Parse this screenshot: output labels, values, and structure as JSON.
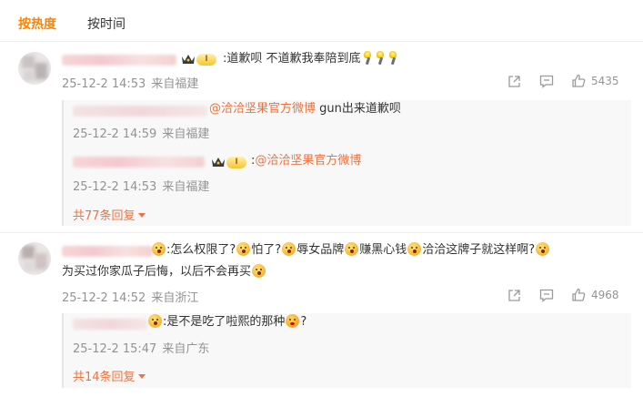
{
  "tabs": [
    {
      "label": "按热度",
      "active": true
    },
    {
      "label": "按时间",
      "active": false
    }
  ],
  "comments": [
    {
      "vip_level": "I",
      "text_prefix": ":道歉呗 不道歉我奉陪到底",
      "time": "25-12-2 14:53",
      "location": "来自福建",
      "likes": "5435",
      "replies": [
        {
          "mention": "@洽洽坚果官方微博",
          "text": " gun出来道歉呗",
          "time": "25-12-2 14:59",
          "location": "来自福建"
        },
        {
          "vip_level": "I",
          "prefix": ":",
          "mention": "@洽洽坚果官方微博",
          "time": "25-12-2 14:53",
          "location": "来自福建"
        }
      ],
      "more_label": "共77条回复"
    },
    {
      "line1_parts": [
        ":怎么权限了?",
        "怕了?",
        "辱女品牌",
        "赚黑心钱",
        "洽洽这牌子就这样啊?"
      ],
      "line2": "为买过你家瓜子后悔，以后不会再买",
      "time": "25-12-2 14:52",
      "location": "来自浙江",
      "likes": "4968",
      "replies": [
        {
          "text": ":是不是吃了啦熙的那种",
          "suffix": "?",
          "time": "25-12-2 15:47",
          "location": "来自广东"
        }
      ],
      "more_label": "共14条回复"
    }
  ],
  "colors": {
    "accent": "#ff8200",
    "mention": "#eb7340",
    "meta": "#939393"
  }
}
